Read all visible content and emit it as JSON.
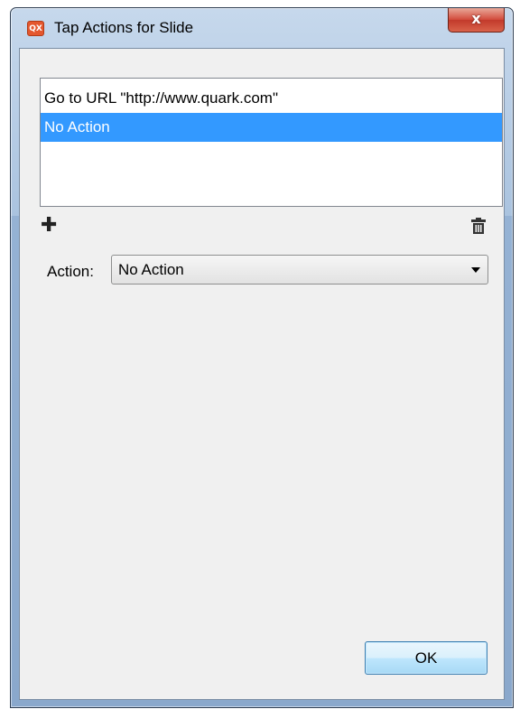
{
  "window": {
    "title": "Tap Actions for Slide",
    "app_icon_text": "QX",
    "close_label": "x"
  },
  "actions_list": {
    "items": [
      {
        "label": "Go to URL \"http://www.quark.com\"",
        "selected": false
      },
      {
        "label": "No Action",
        "selected": true
      }
    ]
  },
  "toolbar": {
    "add_icon": "plus-icon",
    "delete_icon": "trash-icon"
  },
  "action_field": {
    "label": "Action:",
    "selected_value": "No Action"
  },
  "footer": {
    "ok_label": "OK"
  },
  "colors": {
    "selection": "#3399ff",
    "dialog_background": "#f0f0f0",
    "close_button": "#c94a3a"
  }
}
